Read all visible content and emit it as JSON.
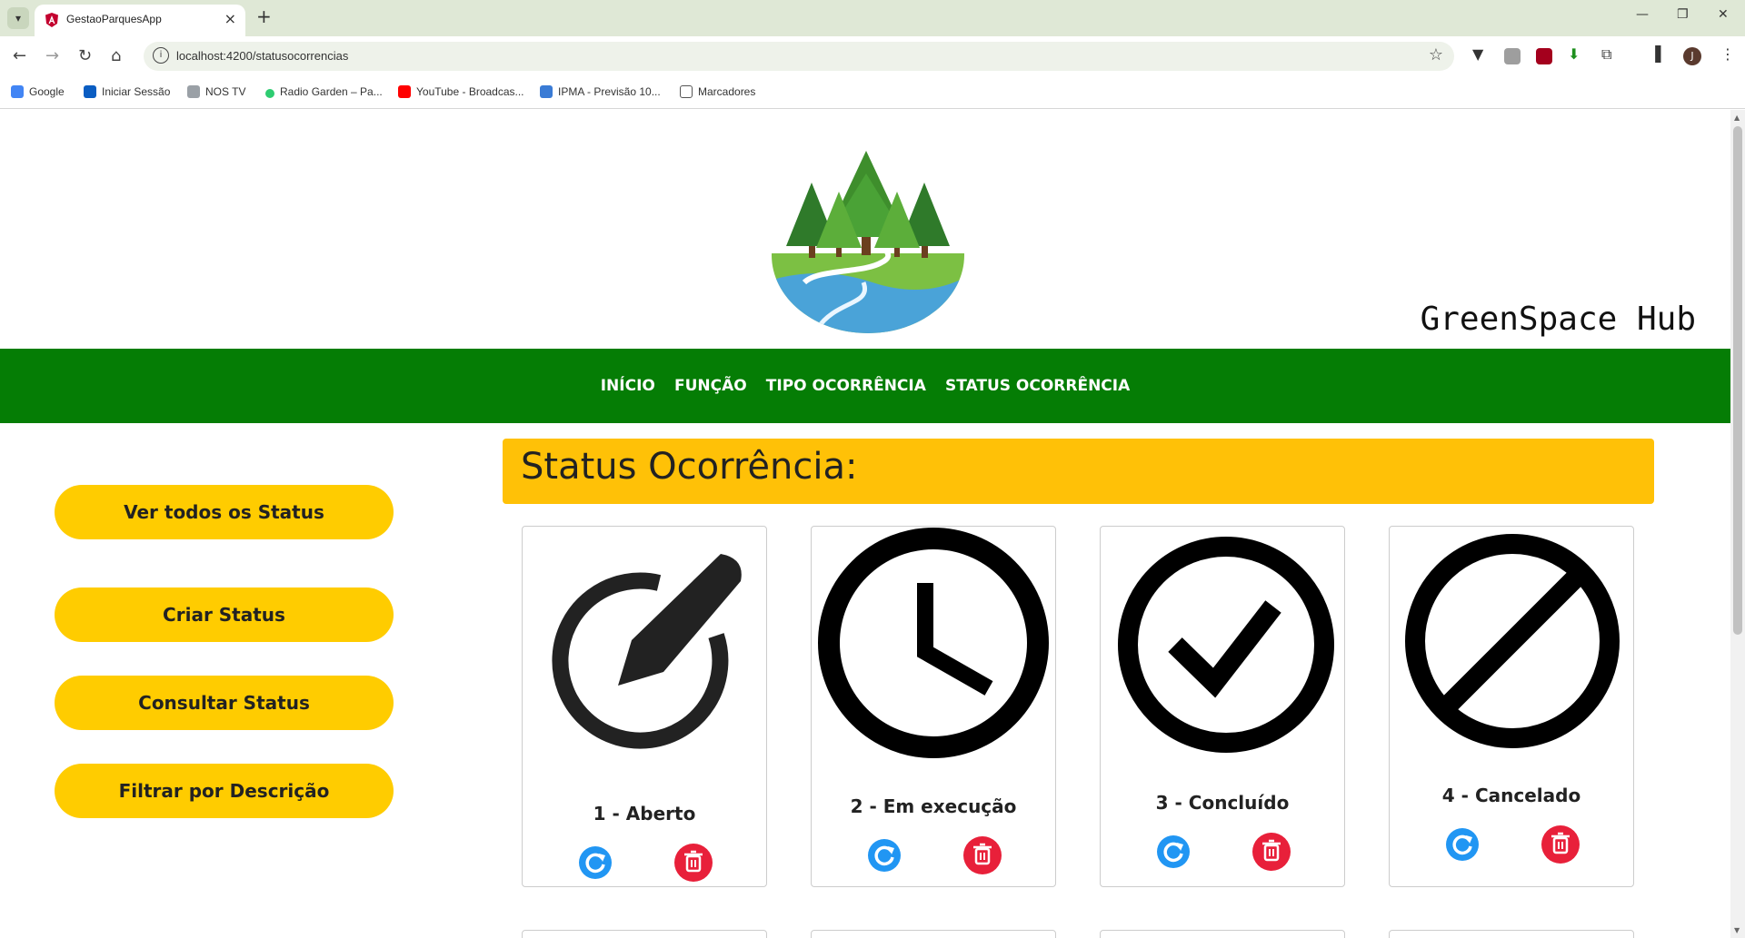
{
  "browser": {
    "tab_title": "GestaoParquesApp",
    "url": "localhost:4200/statusocorrencias",
    "bookmarks": [
      {
        "label": "Google",
        "color": "#4285f4"
      },
      {
        "label": "Iniciar Sessão",
        "color": "#0a5dc2"
      },
      {
        "label": "NOS TV",
        "color": "#9aa0a6"
      },
      {
        "label": "Radio Garden – Pa...",
        "color": "#2ecc71"
      },
      {
        "label": "YouTube - Broadcas...",
        "color": "#ff0000"
      },
      {
        "label": "IPMA - Previsão 10...",
        "color": "#3a7bd5"
      },
      {
        "label": "Marcadores",
        "color": "#555555"
      }
    ],
    "profile_initial": "J"
  },
  "site": {
    "brand": "GreenSpace Hub",
    "nav": [
      "INÍCIO",
      "FUNÇÃO",
      "TIPO OCORRÊNCIA",
      "STATUS OCORRÊNCIA"
    ]
  },
  "sidebar": {
    "buttons": [
      "Ver todos os Status",
      "Criar Status",
      "Consultar Status",
      "Filtrar por Descrição"
    ]
  },
  "main": {
    "title": "Status Ocorrência:",
    "cards": [
      {
        "label": "1 - Aberto",
        "icon": "edit-circle-icon"
      },
      {
        "label": "2 - Em execução",
        "icon": "clock-icon"
      },
      {
        "label": "3 - Concluído",
        "icon": "check-circle-icon"
      },
      {
        "label": "4 - Cancelado",
        "icon": "cancel-circle-icon"
      }
    ]
  },
  "colors": {
    "nav_green": "#057d05",
    "button_yellow": "#ffcc00",
    "header_yellow": "#ffc107",
    "refresh_blue": "#2196f3",
    "delete_red": "#e8203a"
  }
}
